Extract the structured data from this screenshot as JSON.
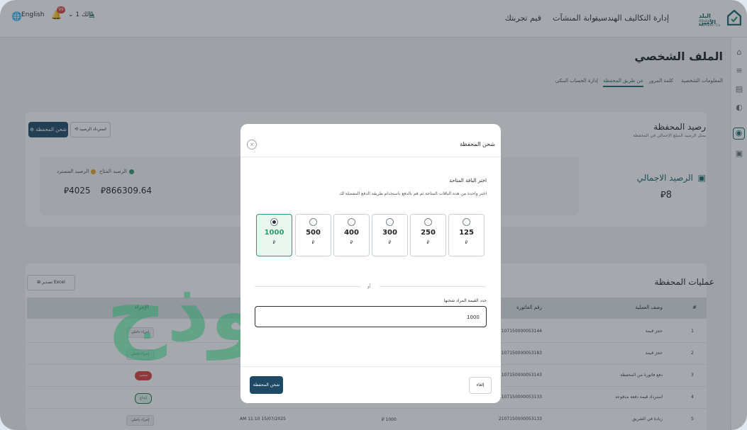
{
  "header": {
    "logo_name": "البلد الأمين",
    "logo_sub": "Albalad Alameen Co.",
    "nav": [
      "إدارة التكاليف الهندسية",
      "بوابة المنشآت",
      "قيم تجربتك"
    ],
    "language": "English",
    "user_name": "مالك 1",
    "notification_count": "99",
    "accent_color": "#1b6b6a"
  },
  "page": {
    "title": "الملف الشخصي",
    "tabs": [
      "المعلومات الشخصية",
      "كلمة المرور",
      "عن طريق المحفظة",
      "إدارة الحساب البنكي"
    ],
    "active_tab": "عن طريق المحفظة"
  },
  "wallet": {
    "title": "رصيد المحفظة",
    "subtitle": "يمثل الرصيد المبلغ الإجمالي في المحفظة",
    "recover_button": "استرداد الرصيد",
    "charge_button": "شحن المحفظة",
    "available_label": "الرصيد المتاح",
    "available_value": "866309.64",
    "withdrawn_label": "الرصيد المسترد",
    "withdrawn_value": "4025",
    "total_label": "الرصيد الاجمالي",
    "total_value": "8",
    "currency": "⃁"
  },
  "operations": {
    "title": "عمليات المحفظة",
    "export_button": "تصدير Excel",
    "columns": [
      "#",
      "وصف العملية",
      "رقم الفاتورة",
      "الإجراء"
    ],
    "rows": [
      {
        "num": "1",
        "desc": "حجز قيمة",
        "invoice": "2107150000053144",
        "amount": "",
        "date": "",
        "action": "إجراء داخلي",
        "action_style": "grey"
      },
      {
        "num": "2",
        "desc": "حجز قيمة",
        "invoice": "2107150000053183",
        "amount": "",
        "date": "",
        "action": "إجراء داخلي",
        "action_style": "grey"
      },
      {
        "num": "3",
        "desc": "دفع فاتورة من المحفظة",
        "invoice": "2107150000053143",
        "amount": "",
        "date": "",
        "action": "سحب",
        "action_style": "red"
      },
      {
        "num": "4",
        "desc": "استرداد قيمة دفعة مدفوعة",
        "invoice": "2107150000053133",
        "amount": "",
        "date": "",
        "action": "إيداع",
        "action_style": "green"
      },
      {
        "num": "5",
        "desc": "زيادة في الشريق",
        "invoice": "2107150000053133",
        "amount": "1000",
        "date": "AM 11:10 15/07/2025",
        "action": "إجراء داخلي",
        "action_style": "grey"
      }
    ]
  },
  "modal": {
    "title": "شحن المحفظة",
    "packages_title": "اختر الباقة المتاحة",
    "packages_subtitle": "اختر واحدة من هذه الباقات المتاحة ثم قم بالدفع باستخدام طريقة الدفع المفضلة لك",
    "packages": [
      "125",
      "250",
      "300",
      "400",
      "500",
      "1000"
    ],
    "selected_package": "1000",
    "or_text": "أو",
    "amount_label": "حدد القيمة المراد شحنها",
    "amount_value": "1000",
    "submit_button": "شحن المحفظة",
    "cancel_button": "إلغاء",
    "close_icon": "close-icon"
  },
  "watermark": "نموذج"
}
